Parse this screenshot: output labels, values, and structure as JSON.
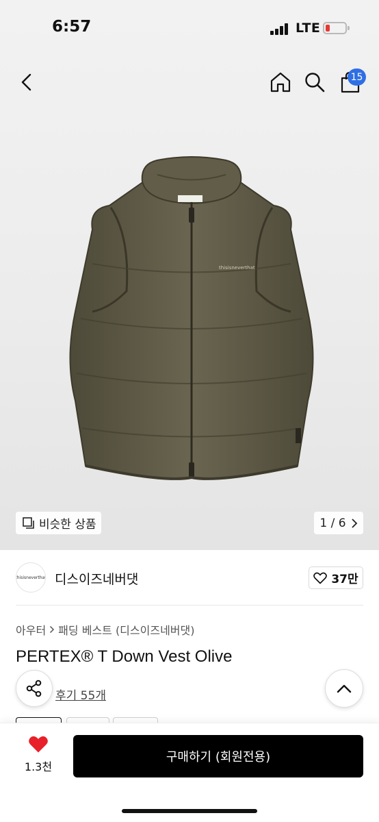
{
  "status_bar": {
    "time": "6:57",
    "network": "LTE",
    "battery_state": "low"
  },
  "header": {
    "icons": [
      "back-chevron-icon",
      "home-icon",
      "search-icon",
      "shopping-bag-icon"
    ],
    "cart_count": "15"
  },
  "gallery": {
    "similar_label": "비슷한 상품",
    "pager": "1 / 6",
    "product_image": "olive down vest"
  },
  "brand": {
    "name": "디스이즈네버댓",
    "logo_text": "thisisneverthat",
    "likes": "37만"
  },
  "product": {
    "breadcrumb": [
      "아우터",
      "패딩 베스트 (디스이즈네버댓)"
    ],
    "title": "PERTEX® T Down Vest Olive",
    "reviews_label": "후기 55개"
  },
  "bottom_bar": {
    "wishlist_count": "1.3천",
    "buy_label": "구매하기 (회원전용)"
  },
  "colors": {
    "accent_blue": "#2f6fe4",
    "heart_red": "#e8202a",
    "vest_olive": "#5f5a46"
  }
}
